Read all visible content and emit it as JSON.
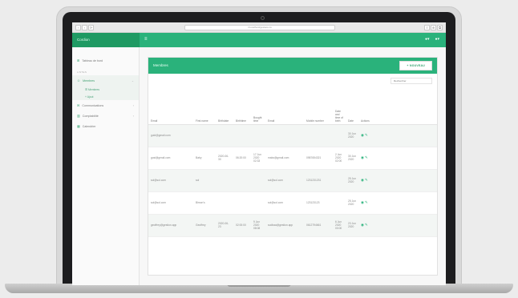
{
  "browser": {
    "url": "rl.localhost/gestaos.rio",
    "nav": [
      "‹",
      "›",
      "⟳"
    ],
    "extra_icons": [
      "⇪",
      "⊕",
      "⧉"
    ]
  },
  "app": {
    "brand": "Cordion",
    "menu_icon": "≡"
  },
  "sidebar": {
    "dashboard": "Tableau de bord",
    "section": "LISTES",
    "membres": "Membres",
    "sub_items": [
      "Membres",
      "Ajout"
    ],
    "communications": "Communications",
    "comptabilite": "Comptabilité",
    "calendrier": "Calendrier"
  },
  "card": {
    "title": "Membres",
    "add_button": "+ NOUVEAU",
    "search_placeholder": "Rechercher"
  },
  "table": {
    "headers": [
      "Email",
      "First name",
      "Birthdate",
      "Birthtime",
      "Bought time",
      "Email",
      "Mobile number",
      "Date and time of birth",
      "Date",
      "Actions"
    ],
    "rows": [
      [
        "guid@gmail.com",
        "",
        "",
        "",
        "",
        "",
        "",
        "",
        "30 Jun 2020",
        ""
      ],
      [
        "gosi@gmail.com",
        "Baby",
        "2020-06-30",
        "06:20:00",
        "17 Jun 2020 02:33",
        "mabc@gmail.com",
        "0987654321",
        "2 Jun 2020 02:00",
        "30 Jun 2020",
        ""
      ],
      [
        "sol@sol.com",
        "sol",
        "",
        "",
        "",
        "sol@sol.com",
        "1231231231",
        "",
        "25 Jun 2020",
        ""
      ],
      [
        "sol@sol.com",
        "Bimon's",
        "",
        "",
        "",
        "sol@sol.com",
        "123123123",
        "",
        "25 Jun 2020",
        ""
      ],
      [
        "geoffrey@gestion.app",
        "Geoffrey",
        "2020-06-23",
        "02:00:00",
        "9 Jun 2020 08:08",
        "sodbaa@gestion.app",
        "0612794661",
        "6 Jun 2020 00:00",
        "23 Jun 2020",
        ""
      ]
    ]
  }
}
